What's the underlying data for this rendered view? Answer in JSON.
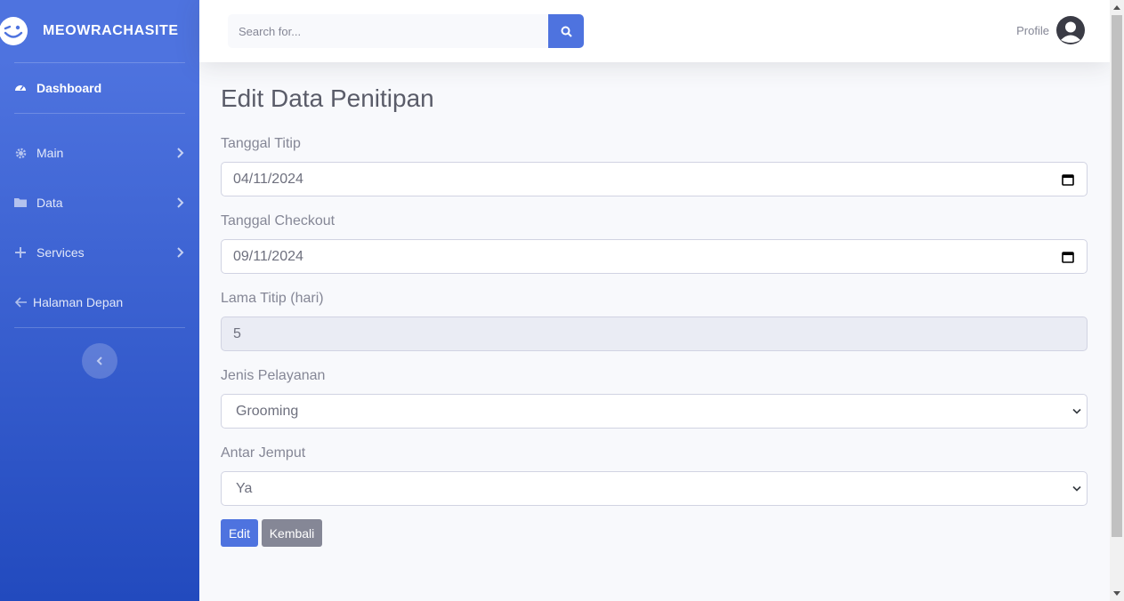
{
  "brand": {
    "name": "MEOWRACHASITE",
    "icon": "wink-face-icon"
  },
  "sidebar": {
    "dashboard": {
      "label": "Dashboard",
      "icon": "tachometer-icon"
    },
    "items": [
      {
        "label": "Main",
        "icon": "gear-icon"
      },
      {
        "label": "Data",
        "icon": "folder-icon"
      },
      {
        "label": "Services",
        "icon": "plus-icon"
      }
    ],
    "back": {
      "label": "Halaman Depan",
      "icon": "arrow-left-icon"
    }
  },
  "search": {
    "placeholder": "Search for..."
  },
  "profile": {
    "label": "Profile"
  },
  "page": {
    "title": "Edit Data Penitipan"
  },
  "form": {
    "tanggal_titip": {
      "label": "Tanggal Titip",
      "value": "04/11/2024"
    },
    "tanggal_checkout": {
      "label": "Tanggal Checkout",
      "value": "09/11/2024"
    },
    "lama_titip": {
      "label": "Lama Titip (hari)",
      "value": "5"
    },
    "jenis_pelayanan": {
      "label": "Jenis Pelayanan",
      "value": "Grooming"
    },
    "antar_jemput": {
      "label": "Antar Jemput",
      "value": "Ya"
    }
  },
  "buttons": {
    "edit": "Edit",
    "kembali": "Kembali"
  },
  "colors": {
    "primary": "#4e73df",
    "secondary": "#858796",
    "sidebar_end": "#224abe"
  }
}
